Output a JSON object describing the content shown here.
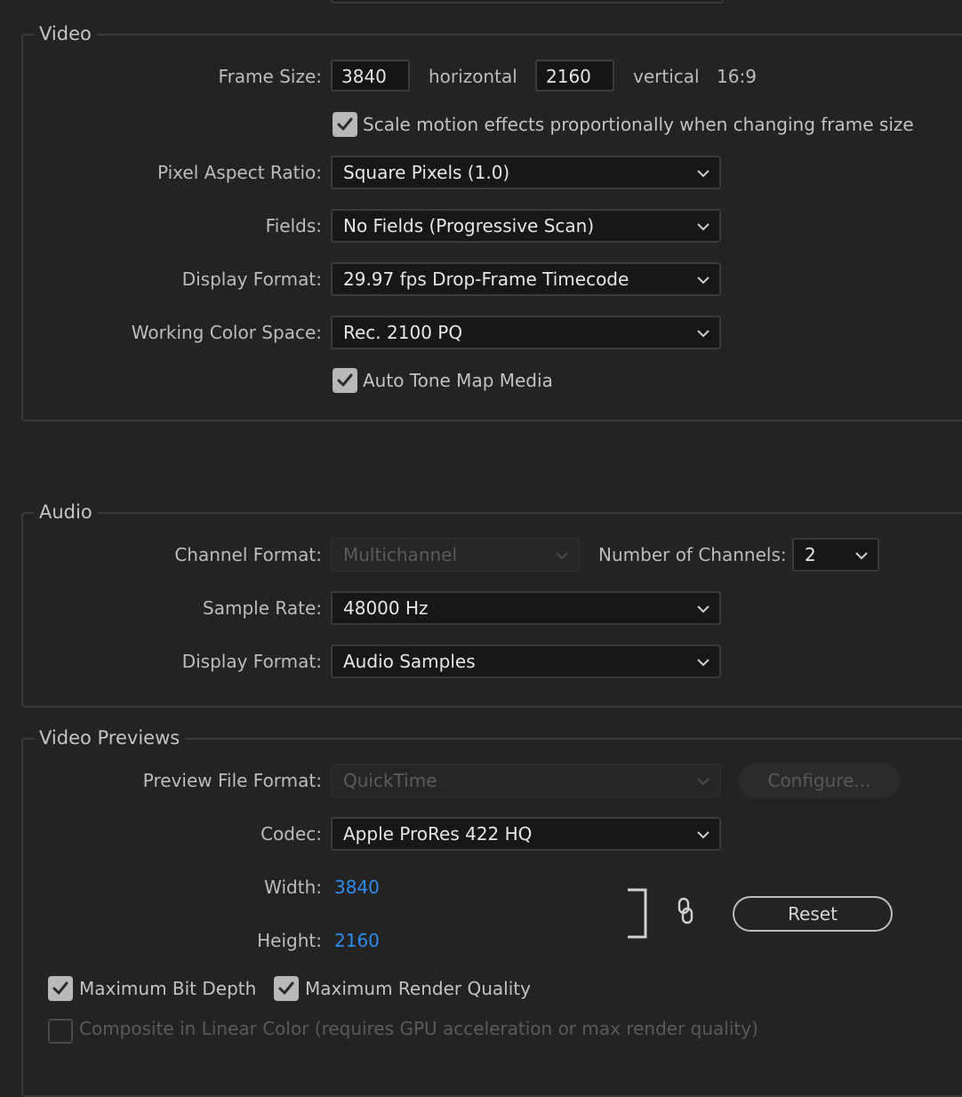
{
  "video": {
    "legend": "Video",
    "frame_size_label": "Frame Size:",
    "width": "3840",
    "horizontal_label": "horizontal",
    "height": "2160",
    "vertical_label": "vertical",
    "aspect": "16:9",
    "scale_motion": {
      "label": "Scale motion effects proportionally when changing frame size",
      "checked": true
    },
    "pixel_aspect_label": "Pixel Aspect Ratio:",
    "pixel_aspect_value": "Square Pixels (1.0)",
    "fields_label": "Fields:",
    "fields_value": "No Fields (Progressive Scan)",
    "display_format_label": "Display Format:",
    "display_format_value": "29.97 fps Drop-Frame Timecode",
    "color_space_label": "Working Color Space:",
    "color_space_value": "Rec. 2100 PQ",
    "auto_tone_map": {
      "label": "Auto Tone Map Media",
      "checked": true
    }
  },
  "audio": {
    "legend": "Audio",
    "channel_format_label": "Channel Format:",
    "channel_format_value": "Multichannel",
    "num_channels_label": "Number of Channels:",
    "num_channels_value": "2",
    "sample_rate_label": "Sample Rate:",
    "sample_rate_value": "48000 Hz",
    "display_format_label": "Display Format:",
    "display_format_value": "Audio Samples"
  },
  "previews": {
    "legend": "Video Previews",
    "file_format_label": "Preview File Format:",
    "file_format_value": "QuickTime",
    "configure_label": "Configure...",
    "codec_label": "Codec:",
    "codec_value": "Apple ProRes 422 HQ",
    "width_label": "Width:",
    "width_value": "3840",
    "height_label": "Height:",
    "height_value": "2160",
    "reset_label": "Reset",
    "max_bit_depth": {
      "label": "Maximum Bit Depth",
      "checked": true
    },
    "max_render_quality": {
      "label": "Maximum Render Quality",
      "checked": true
    },
    "composite_linear": {
      "label": "Composite in Linear Color (requires GPU acceleration or max render quality)",
      "checked": false
    }
  },
  "colors": {
    "background": "#232323",
    "link": "#2d8ceb",
    "checkbox": "#b9b9b9"
  }
}
